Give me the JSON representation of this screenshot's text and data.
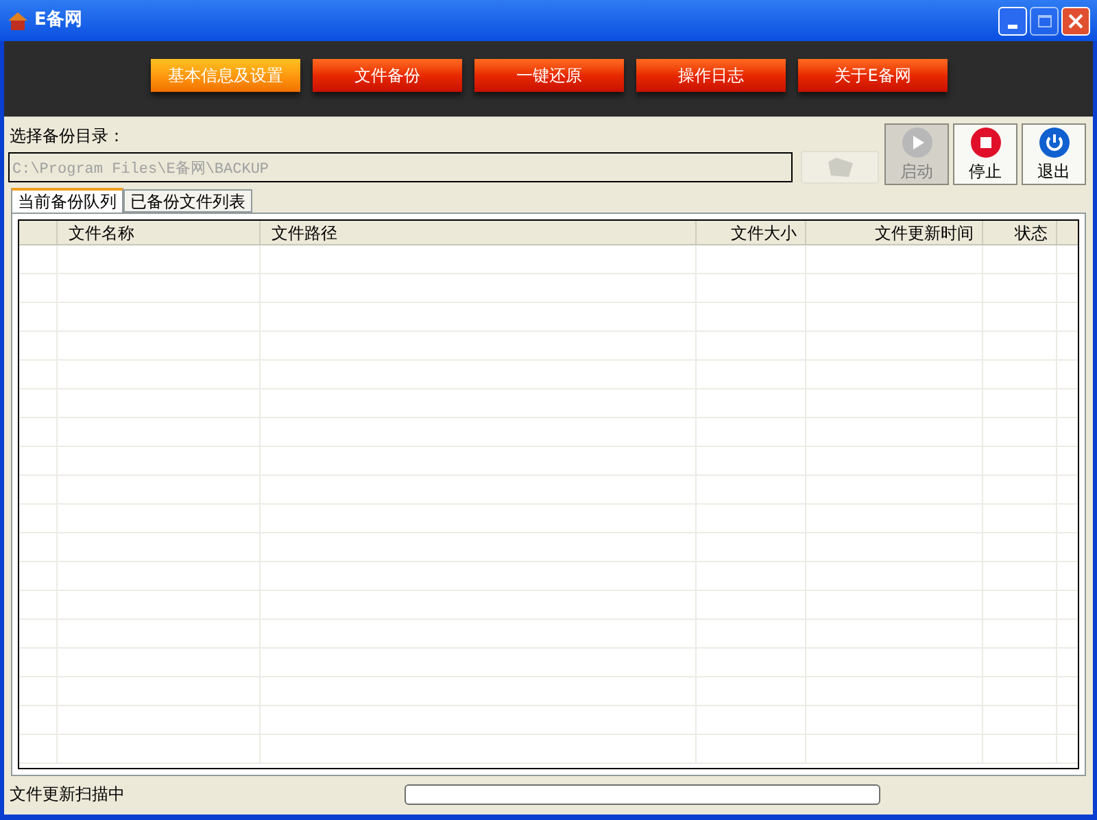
{
  "window": {
    "title": "E备网"
  },
  "nav": [
    {
      "label": "基本信息及设置",
      "selected": true
    },
    {
      "label": "文件备份",
      "selected": false
    },
    {
      "label": "一键还原",
      "selected": false
    },
    {
      "label": "操作日志",
      "selected": false
    },
    {
      "label": "关于E备网",
      "selected": false
    }
  ],
  "backup_dir": {
    "label": "选择备份目录：",
    "value": "C:\\Program Files\\E备网\\BACKUP",
    "browse_disabled": true
  },
  "actions": [
    {
      "kind": "start",
      "label": "启动",
      "disabled": true
    },
    {
      "kind": "stop",
      "label": "停止",
      "disabled": false
    },
    {
      "kind": "exit",
      "label": "退出",
      "disabled": false
    }
  ],
  "tabs": [
    {
      "label": "当前备份队列",
      "selected": true
    },
    {
      "label": "已备份文件列表",
      "selected": false
    }
  ],
  "table": {
    "columns": [
      {
        "label": "文件名称"
      },
      {
        "label": "文件路径"
      },
      {
        "label": "文件大小"
      },
      {
        "label": "文件更新时间"
      },
      {
        "label": "状态"
      }
    ]
  },
  "status_bar": {
    "text": "文件更新扫描中",
    "progress": {
      "level": 0
    }
  }
}
